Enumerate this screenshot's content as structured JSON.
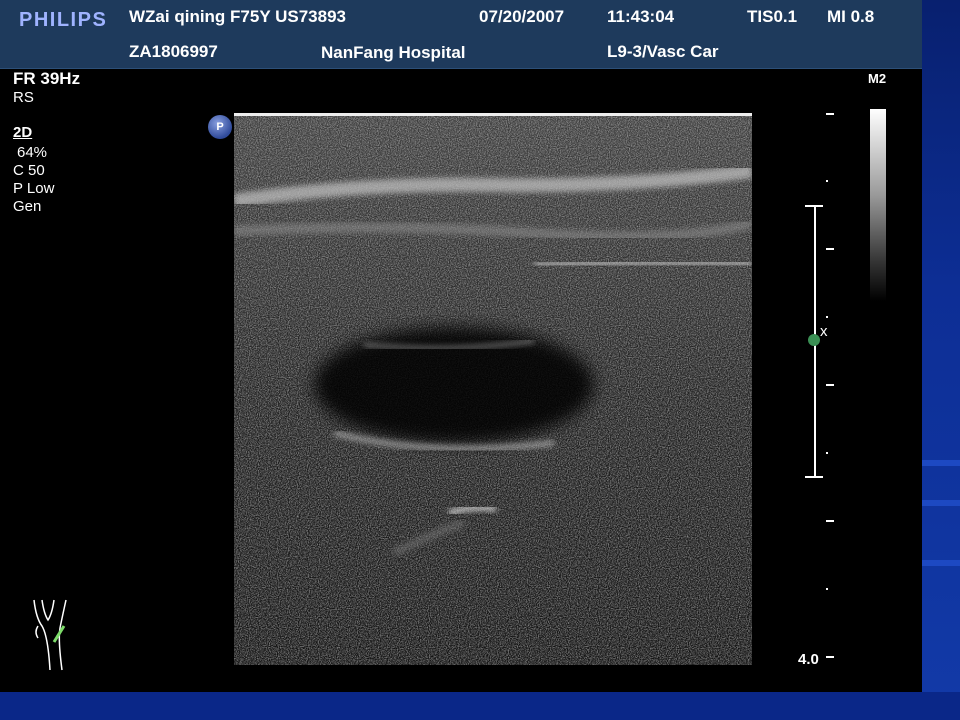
{
  "header": {
    "logo": "PHILIPS",
    "patient": "WZai qining F75Y US73893",
    "date": "07/20/2007",
    "time": "11:43:04",
    "tis": "TIS0.1",
    "mi": "MI 0.8",
    "id": "ZA1806997",
    "hospital": "NanFang Hospital",
    "probe": "L9-3/Vasc Car"
  },
  "params": {
    "frame_rate": "FR 39Hz",
    "rs": "RS",
    "mode": "2D",
    "gain": "64%",
    "compression": "C 50",
    "persistence": "P Low",
    "gen": "Gen"
  },
  "scale": {
    "gray_map": "M2",
    "depth": "4.0",
    "focus_marker": "x"
  },
  "badge": {
    "label": "P"
  },
  "colors": {
    "slide_bg": "#0b2a8a",
    "header_bg": "#1e3a5c",
    "logo": "#9fb3ff",
    "focus_dot": "#3a8f54",
    "probe_line": "#7ddc6a"
  }
}
